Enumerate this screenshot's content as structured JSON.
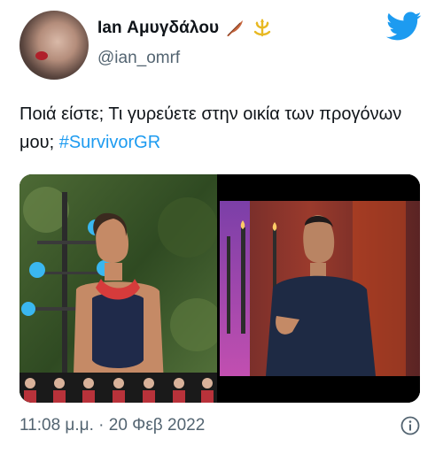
{
  "tweet": {
    "display_name": "Ian Αμυγδάλου",
    "handle": "@ian_omrf",
    "text_before_hashtag": "Ποιά είστε; Τι γυρεύετε στην οικία των προγόνων μου; ",
    "hashtag": "#SurvivorGR",
    "timestamp": "11:08 μ.μ. · 20 Φεβ 2022"
  },
  "icons": {
    "badges": [
      "feather-icon",
      "trident-icon"
    ],
    "brand": "twitter-bird-icon",
    "info": "info-icon"
  },
  "colors": {
    "link": "#1d9bf0",
    "twitter_blue": "#1d9bf0",
    "secondary_text": "#536471"
  }
}
